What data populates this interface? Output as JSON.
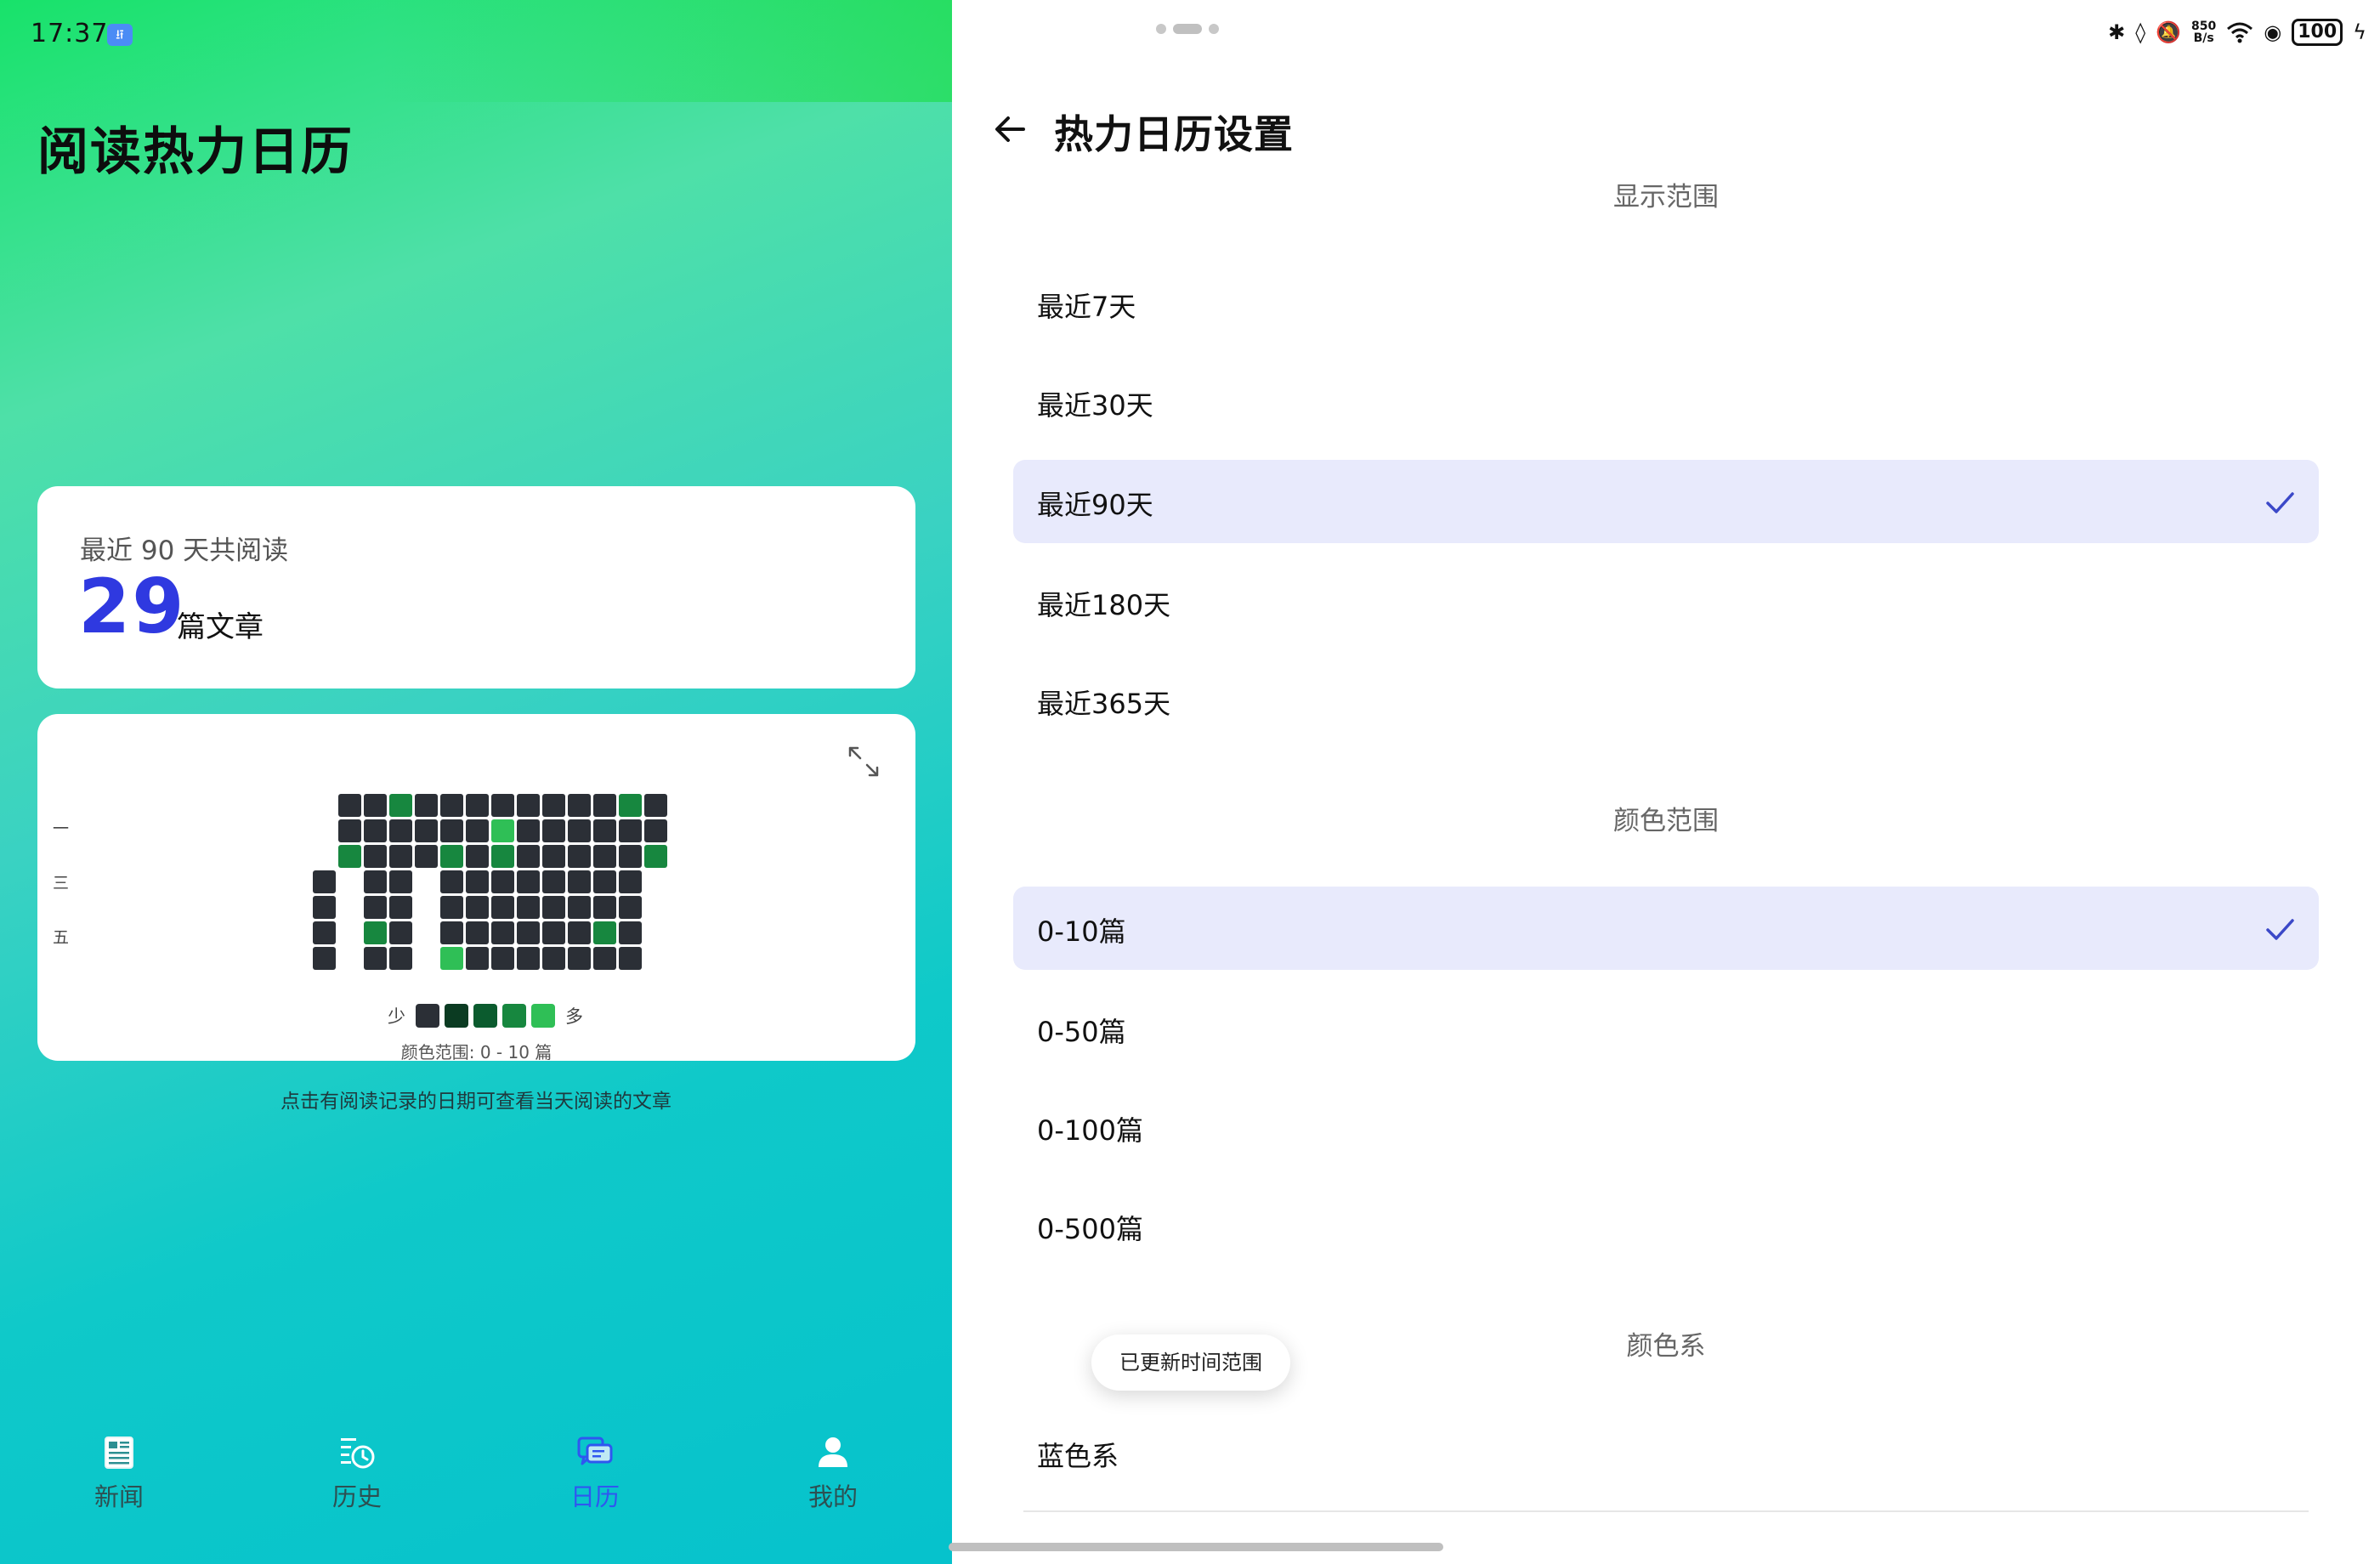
{
  "status_bar": {
    "time": "17:37",
    "net_speed_top": "850",
    "net_speed_bottom": "B/s",
    "battery": "100"
  },
  "left": {
    "title": "阅读热力日历",
    "summary": {
      "label": "最近 90 天共阅读",
      "count": "29",
      "unit": "篇文章"
    },
    "heatmap": {
      "weekday_labels": [
        "一",
        "三",
        "五"
      ],
      "legend_less": "少",
      "legend_more": "多",
      "legend_colors": [
        "#2b2f36",
        "#0b3b22",
        "#0b5b2e",
        "#17873f",
        "#2fbf56"
      ],
      "empty_color": "#2b2f36",
      "range_note": "颜色范围: 0 - 10 篇",
      "rows": [
        [
          -1,
          0,
          0,
          3,
          0,
          0,
          0,
          0,
          0,
          0,
          0,
          0,
          3,
          0
        ],
        [
          -1,
          0,
          0,
          0,
          0,
          0,
          0,
          4,
          0,
          0,
          0,
          0,
          0,
          0
        ],
        [
          -1,
          3,
          0,
          0,
          0,
          3,
          0,
          3,
          0,
          0,
          0,
          0,
          0,
          3
        ],
        [
          0,
          -1,
          0,
          0,
          -1,
          0,
          0,
          0,
          0,
          0,
          0,
          0,
          0,
          -1
        ],
        [
          0,
          -1,
          0,
          0,
          -1,
          0,
          0,
          0,
          0,
          0,
          0,
          0,
          0,
          -1
        ],
        [
          0,
          -1,
          3,
          0,
          -1,
          0,
          0,
          0,
          0,
          0,
          0,
          3,
          0,
          -1
        ],
        [
          0,
          -1,
          0,
          0,
          -1,
          4,
          0,
          0,
          0,
          0,
          0,
          0,
          0,
          -1
        ]
      ]
    },
    "hint": "点击有阅读记录的日期可查看当天阅读的文章",
    "tabs": [
      {
        "label": "新闻",
        "icon": "news-icon",
        "active": false
      },
      {
        "label": "历史",
        "icon": "history-icon",
        "active": false
      },
      {
        "label": "日历",
        "icon": "calendar-chat-icon",
        "active": true
      },
      {
        "label": "我的",
        "icon": "profile-icon",
        "active": false
      }
    ]
  },
  "right": {
    "title": "热力日历设置",
    "sections": [
      {
        "header": "显示范围",
        "options": [
          {
            "label": "最近7天",
            "selected": false
          },
          {
            "label": "最近30天",
            "selected": false
          },
          {
            "label": "最近90天",
            "selected": true
          },
          {
            "label": "最近180天",
            "selected": false
          },
          {
            "label": "最近365天",
            "selected": false
          }
        ]
      },
      {
        "header": "颜色范围",
        "options": [
          {
            "label": "0-10篇",
            "selected": true
          },
          {
            "label": "0-50篇",
            "selected": false
          },
          {
            "label": "0-100篇",
            "selected": false
          },
          {
            "label": "0-500篇",
            "selected": false
          }
        ]
      },
      {
        "header": "颜色系",
        "options": [
          {
            "label": "蓝色系",
            "selected": false
          }
        ]
      }
    ],
    "toast": "已更新时间范围",
    "accent_color": "#3b48c8",
    "selected_bg": "#e8eafc"
  }
}
